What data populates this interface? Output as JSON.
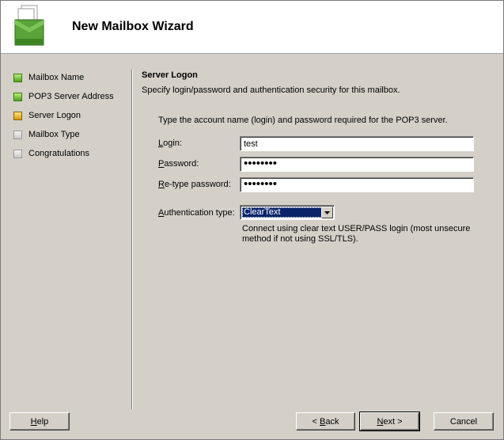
{
  "wizard": {
    "title": "New Mailbox Wizard"
  },
  "steps": [
    {
      "label": "Mailbox Name",
      "state": "done"
    },
    {
      "label": "POP3 Server Address",
      "state": "done"
    },
    {
      "label": "Server Logon",
      "state": "current"
    },
    {
      "label": "Mailbox Type",
      "state": "pending"
    },
    {
      "label": "Congratulations",
      "state": "pending"
    }
  ],
  "page": {
    "title": "Server Logon",
    "description": "Specify login/password and authentication security for this mailbox.",
    "instructions": "Type the account name (login) and password required for the POP3 server."
  },
  "fields": {
    "login": {
      "label_mnemonic": "L",
      "label_rest": "ogin:",
      "value": "test"
    },
    "password": {
      "label_mnemonic": "P",
      "label_rest": "assword:",
      "value": "••••••••"
    },
    "retype": {
      "label_mnemonic": "R",
      "label_rest": "e-type password:",
      "value": "••••••••"
    }
  },
  "auth": {
    "label_mnemonic": "A",
    "label_rest": "uthentication type:",
    "selected": "ClearText",
    "description": "Connect using clear text USER/PASS login (most unsecure method if not using SSL/TLS)."
  },
  "buttons": {
    "help": {
      "mnemonic": "H",
      "rest": "elp"
    },
    "back_prefix": "< ",
    "back": {
      "mnemonic": "B",
      "rest": "ack"
    },
    "next": {
      "mnemonic": "N",
      "rest": "ext"
    },
    "next_suffix": " >",
    "cancel": "Cancel"
  },
  "colors": {
    "done": "#4fa31f",
    "current": "#d79a00",
    "pending": "#c9c9c9",
    "selection": "#0a246a"
  }
}
